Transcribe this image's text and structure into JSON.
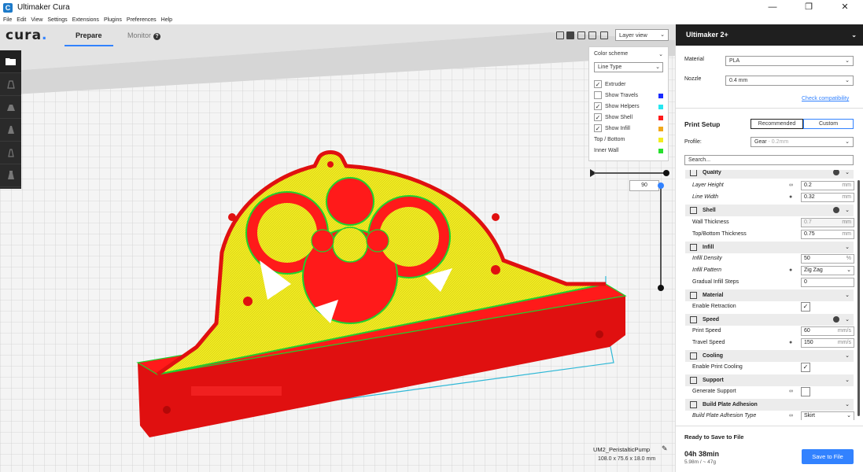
{
  "window": {
    "title": "Ultimaker Cura",
    "minimize": "—",
    "maximize": "❐",
    "close": "✕"
  },
  "menu": [
    "File",
    "Edit",
    "View",
    "Settings",
    "Extensions",
    "Plugins",
    "Preferences",
    "Help"
  ],
  "header": {
    "logo": "cura",
    "logo_dot": ".",
    "tab_prepare": "Prepare",
    "tab_monitor": "Monitor",
    "monitor_info": "?",
    "view_mode": "Layer view"
  },
  "color_panel": {
    "title": "Color scheme",
    "scheme": "Line Type",
    "rows": [
      {
        "label": "Extruder",
        "checked": true
      },
      {
        "label": "Show Travels",
        "checked": false,
        "color": "#1a2bff"
      },
      {
        "label": "Show Helpers",
        "checked": true,
        "color": "#26e6f0"
      },
      {
        "label": "Show Shell",
        "checked": true,
        "color": "#ff1a1a"
      },
      {
        "label": "Show Infill",
        "checked": true,
        "color": "#f0a81a"
      },
      {
        "label": "Top / Bottom",
        "color": "#f2ec21"
      },
      {
        "label": "Inner Wall",
        "color": "#28e02e"
      }
    ]
  },
  "layer_slider": {
    "value": "90"
  },
  "object": {
    "name": "UM2_PeristalticPump",
    "dims": "108.0 x 75.6 x 18.0 mm"
  },
  "sidebar": {
    "machine": "Ultimaker 2+",
    "material_label": "Material",
    "material_value": "PLA",
    "nozzle_label": "Nozzle",
    "nozzle_value": "0.4 mm",
    "check_compat": "Check compatibility",
    "print_setup": "Print Setup",
    "recommended": "Recommended",
    "custom": "Custom",
    "profile_label": "Profile:",
    "profile_value": "Gear",
    "profile_suffix": "- 0.2mm",
    "search_placeholder": "Search..."
  },
  "settings": {
    "quality": "Quality",
    "layer_height": "Layer Height",
    "layer_height_val": "0.2",
    "mm": "mm",
    "line_width": "Line Width",
    "line_width_val": "0.32",
    "shell": "Shell",
    "wall_thickness": "Wall Thickness",
    "wall_thickness_val": "0.7",
    "topbottom_thickness": "Top/Bottom Thickness",
    "topbottom_thickness_val": "0.75",
    "infill": "Infill",
    "infill_density": "Infill Density",
    "infill_density_val": "50",
    "pct": "%",
    "infill_pattern": "Infill Pattern",
    "infill_pattern_val": "Zig Zag",
    "gradual_infill": "Gradual Infill Steps",
    "gradual_infill_val": "0",
    "material": "Material",
    "enable_retraction": "Enable Retraction",
    "speed": "Speed",
    "print_speed": "Print Speed",
    "print_speed_val": "60",
    "mms": "mm/s",
    "travel_speed": "Travel Speed",
    "travel_speed_val": "150",
    "cooling": "Cooling",
    "enable_cooling": "Enable Print Cooling",
    "support": "Support",
    "generate_support": "Generate Support",
    "adhesion": "Build Plate Adhesion",
    "adhesion_type": "Build Plate Adhesion Type",
    "adhesion_type_val": "Skirt"
  },
  "footer": {
    "ready": "Ready to Save to File",
    "time": "04h 38min",
    "material": "5.98m / ~ 47g",
    "save": "Save to File"
  }
}
